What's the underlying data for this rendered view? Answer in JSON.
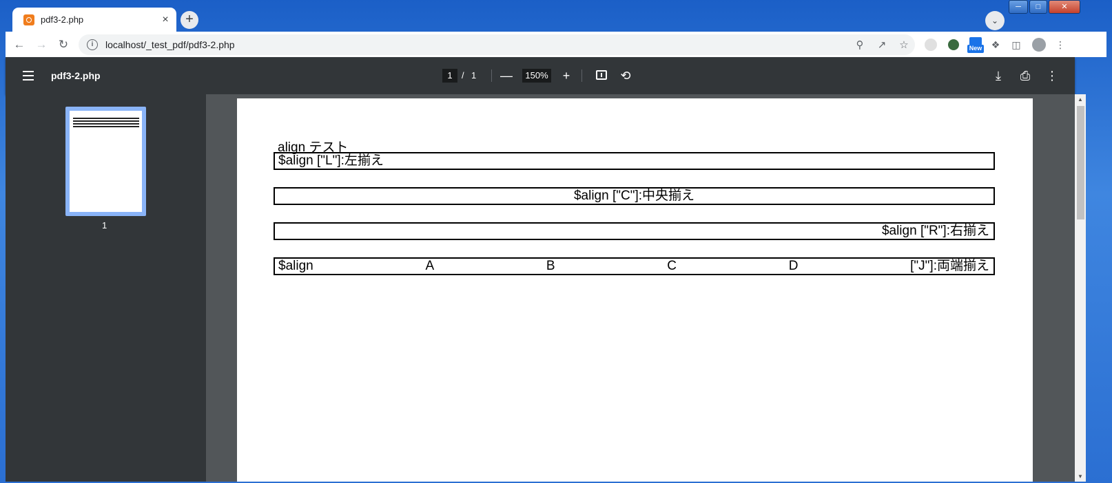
{
  "browser": {
    "tab_title": "pdf3-2.php",
    "tab_close": "×",
    "new_tab": "+",
    "url": "localhost/_test_pdf/pdf3-2.php",
    "new_badge": "New"
  },
  "pdf_toolbar": {
    "title": "pdf3-2.php",
    "page_current": "1",
    "page_separator": "/",
    "page_total": "1",
    "zoom": "150%",
    "zoom_out": "—",
    "zoom_in": "+"
  },
  "sidebar": {
    "thumbnail_label": "1"
  },
  "document": {
    "heading": "align テスト",
    "row_left": "$align [\"L\"]:左揃え",
    "row_center": "$align [\"C\"]:中央揃え",
    "row_right": "$align [\"R\"]:右揃え",
    "row_justify": [
      "$align",
      "A",
      "B",
      "C",
      "D",
      "[\"J\"]:両端揃え"
    ]
  }
}
